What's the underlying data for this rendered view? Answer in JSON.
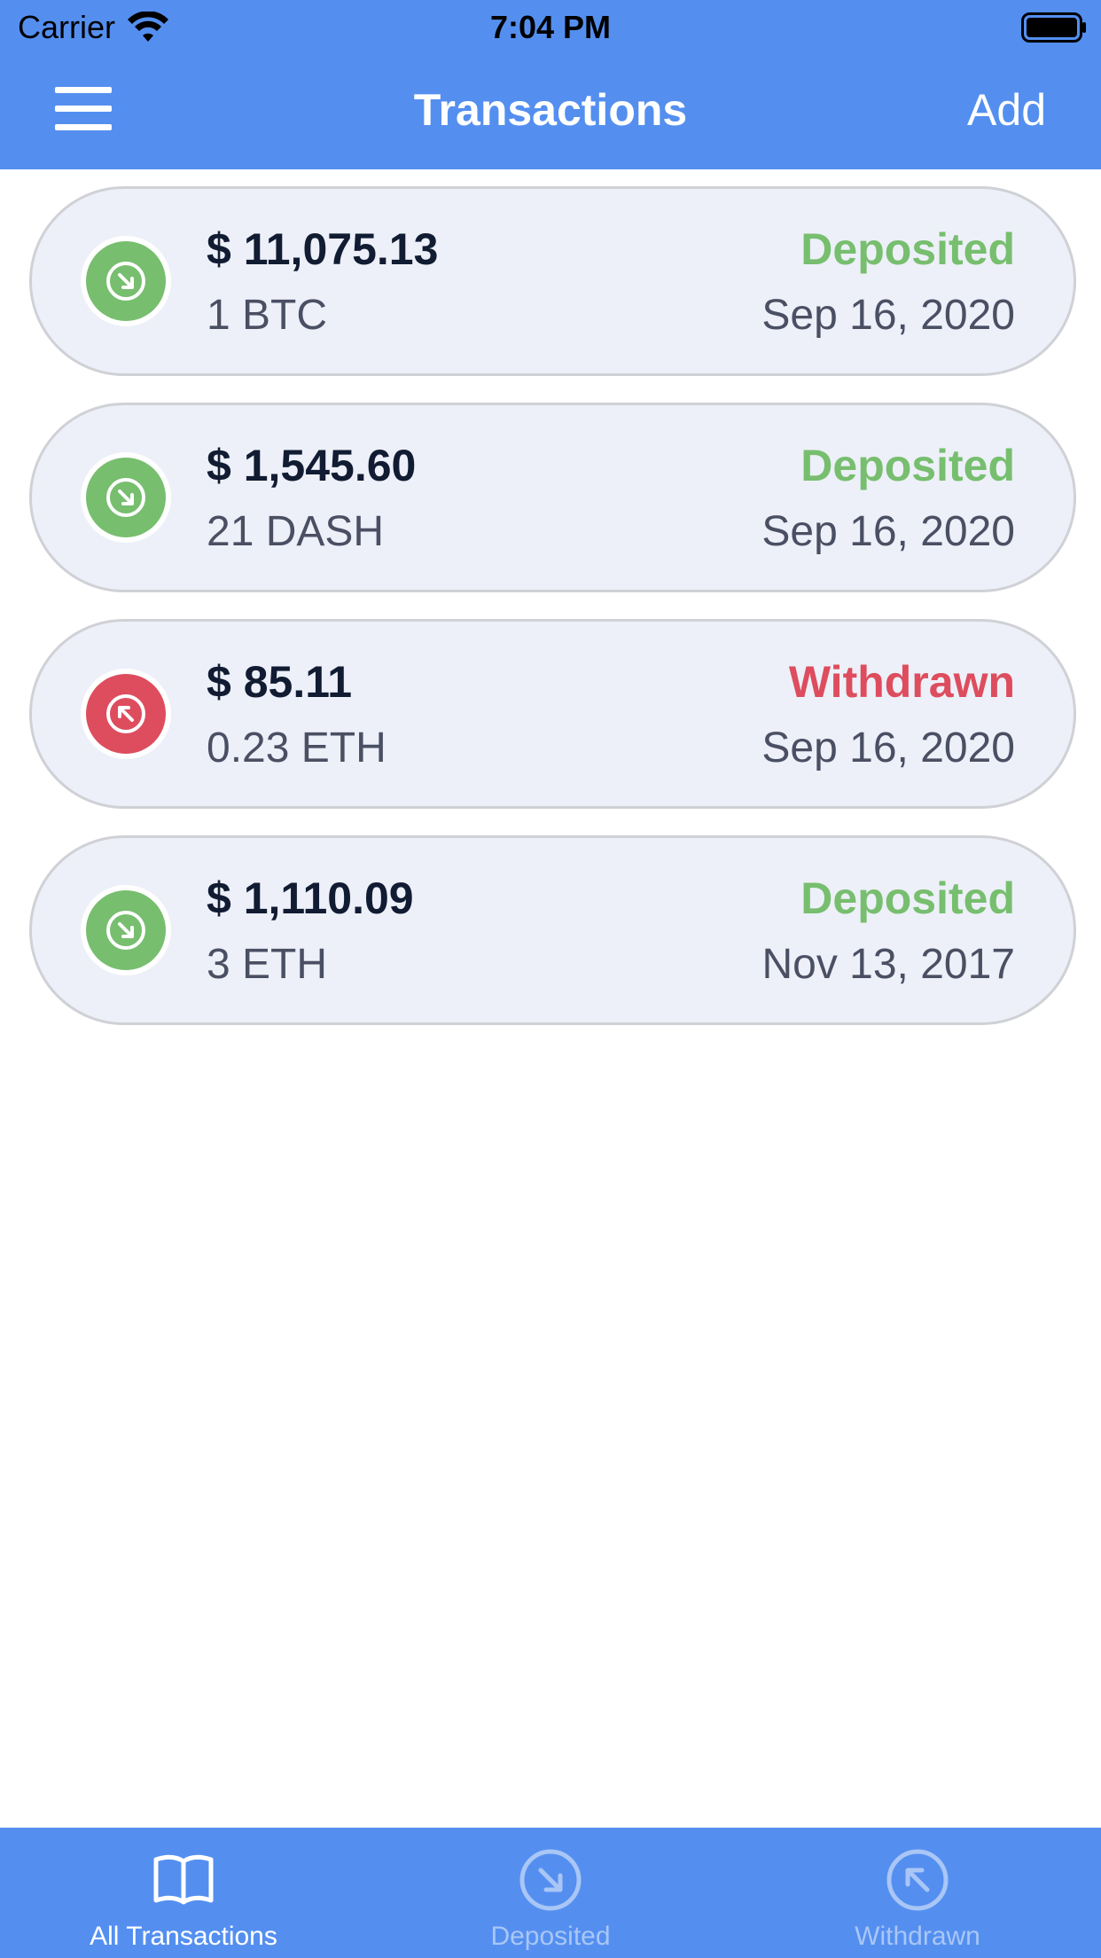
{
  "status_bar": {
    "carrier": "Carrier",
    "time": "7:04 PM"
  },
  "nav": {
    "title": "Transactions",
    "add_label": "Add",
    "menu_icon": "hamburger-menu-icon"
  },
  "colors": {
    "primary": "#548ff0",
    "deposited": "#77be6f",
    "withdrawn": "#dd4d5e",
    "card_bg": "#edf0f8",
    "amount_text": "#111c33",
    "secondary_text": "#4b4f63",
    "tab_inactive": "#a9c6f6"
  },
  "transactions": [
    {
      "amount": "$ 11,075.13",
      "crypto": "1 BTC",
      "status": "Deposited",
      "date": "Sep 16, 2020",
      "type": "deposit",
      "icon": "arrow-down-right-circle-icon"
    },
    {
      "amount": "$ 1,545.60",
      "crypto": "21 DASH",
      "status": "Deposited",
      "date": "Sep 16, 2020",
      "type": "deposit",
      "icon": "arrow-down-right-circle-icon"
    },
    {
      "amount": "$ 85.11",
      "crypto": "0.23 ETH",
      "status": "Withdrawn",
      "date": "Sep 16, 2020",
      "type": "withdraw",
      "icon": "arrow-up-left-circle-icon"
    },
    {
      "amount": "$ 1,110.09",
      "crypto": "3 ETH",
      "status": "Deposited",
      "date": "Nov 13, 2017",
      "type": "deposit",
      "icon": "arrow-down-right-circle-icon"
    }
  ],
  "tabs": [
    {
      "label": "All Transactions",
      "icon": "open-book-icon",
      "active": true
    },
    {
      "label": "Deposited",
      "icon": "arrow-down-right-circle-icon",
      "active": false
    },
    {
      "label": "Withdrawn",
      "icon": "arrow-up-left-circle-icon",
      "active": false
    }
  ]
}
